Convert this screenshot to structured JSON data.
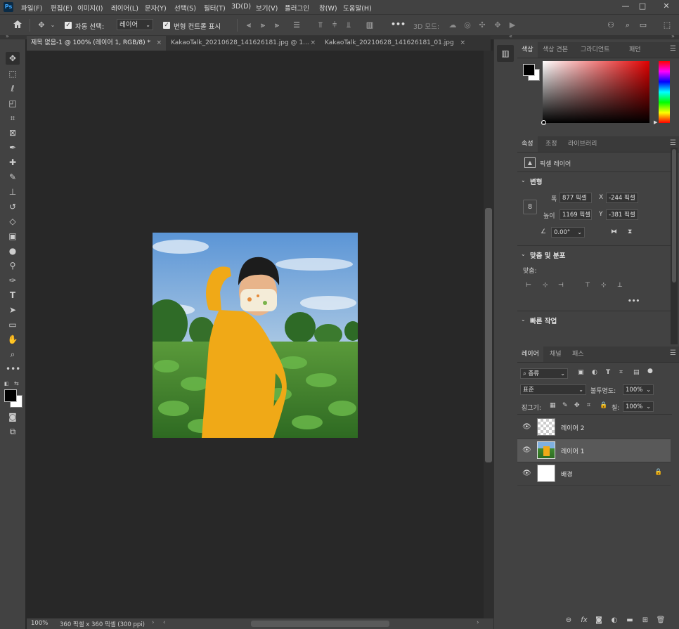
{
  "app": {
    "logo": "Ps",
    "menu": [
      "파일(F)",
      "편집(E)",
      "이미지(I)",
      "레이어(L)",
      "문자(Y)",
      "선택(S)",
      "필터(T)",
      "3D(D)",
      "보기(V)",
      "플러그인",
      "창(W)",
      "도움말(H)"
    ],
    "window_controls": {
      "minimize": "—",
      "restore": "□",
      "close": "✕"
    }
  },
  "options_bar": {
    "auto_select_label": "자동 선택:",
    "auto_select_value": "레이어",
    "transform_controls_label": "변형 컨트롤 표시",
    "mode_3d_label": "3D 모드:",
    "more": "•••"
  },
  "tabs": [
    {
      "label": "제목 없음-1 @ 100% (레이어 1, RGB/8) *",
      "active": true
    },
    {
      "label": "KakaoTalk_20210628_141626181.jpg @ 1...",
      "active": false
    },
    {
      "label": "KakaoTalk_20210628_141626181_01.jpg",
      "active": false
    }
  ],
  "tab_close": "×",
  "status": {
    "zoom": "100%",
    "doc_info": "360 픽셀 x 360 픽셀 (300 ppi)"
  },
  "color_panel": {
    "tabs": [
      "색상",
      "색상 견본",
      "그라디언트",
      "패턴"
    ],
    "foreground": "#000000",
    "background": "#ffffff",
    "hue_color": "#e00000"
  },
  "properties_panel": {
    "tabs": [
      "속성",
      "조정",
      "라이브러리"
    ],
    "layer_type": "픽셀 레이어",
    "transform_title": "변형",
    "width_label": "폭",
    "width_value": "877 픽셀",
    "height_label": "높이",
    "height_value": "1169 픽셀",
    "x_label": "X",
    "x_value": "-244 픽셀",
    "y_label": "Y",
    "y_value": "-381 픽셀",
    "angle_value": "0.00°",
    "align_title": "맞춤 및 분포",
    "align_label": "맞춤:",
    "quick_actions_title": "빠른 작업",
    "more": "•••"
  },
  "layers_panel": {
    "tabs": [
      "레이어",
      "채널",
      "패스"
    ],
    "filter_kind": "종류",
    "blend_mode": "표준",
    "opacity_label": "불투명도:",
    "opacity_value": "100%",
    "lock_label": "잠그기:",
    "fill_label": "칠:",
    "fill_value": "100%",
    "layers": [
      {
        "name": "레이어 2",
        "selected": false,
        "thumb": "transparent"
      },
      {
        "name": "레이어 1",
        "selected": true,
        "thumb": "photo"
      },
      {
        "name": "배경",
        "selected": false,
        "thumb": "white",
        "locked": true
      }
    ]
  }
}
